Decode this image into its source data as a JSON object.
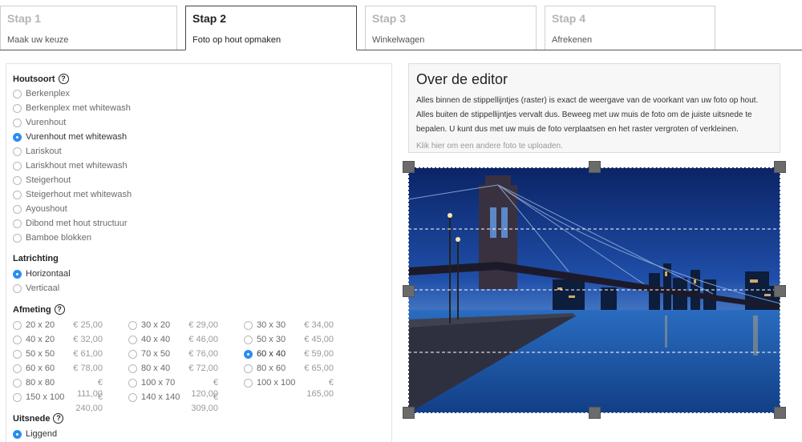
{
  "steps": [
    {
      "title": "Stap 1",
      "subtitle": "Maak uw keuze"
    },
    {
      "title": "Stap 2",
      "subtitle": "Foto op hout opmaken"
    },
    {
      "title": "Stap 3",
      "subtitle": "Winkelwagen"
    },
    {
      "title": "Stap 4",
      "subtitle": "Afrekenen"
    }
  ],
  "houtsoort": {
    "title": "Houtsoort",
    "selected": "Vurenhout met whitewash",
    "options": [
      "Berkenplex",
      "Berkenplex met whitewash",
      "Vurenhout",
      "Vurenhout met whitewash",
      "Lariskout",
      "Lariskhout met whitewash",
      "Steigerhout",
      "Steigerhout met whitewash",
      "Ayoushout",
      "Dibond met hout structuur",
      "Bamboe blokken"
    ]
  },
  "latrichting": {
    "title": "Latrichting",
    "selected": "Horizontaal",
    "options": [
      "Horizontaal",
      "Verticaal"
    ]
  },
  "afmeting": {
    "title": "Afmeting",
    "selected": "60 x 40",
    "columns": [
      [
        {
          "size": "20 x 20",
          "price": "€ 25,00"
        },
        {
          "size": "40 x 20",
          "price": "€ 32,00"
        },
        {
          "size": "50 x 50",
          "price": "€ 61,00"
        },
        {
          "size": "60 x 60",
          "price": "€ 78,00"
        },
        {
          "size": "80 x 80",
          "price": "€ 111,00"
        },
        {
          "size": "150 x 100",
          "price": "€ 240,00"
        }
      ],
      [
        {
          "size": "30 x 20",
          "price": "€ 29,00"
        },
        {
          "size": "40 x 40",
          "price": "€ 46,00"
        },
        {
          "size": "70 x 50",
          "price": "€ 76,00"
        },
        {
          "size": "80 x 40",
          "price": "€ 72,00"
        },
        {
          "size": "100 x 70",
          "price": "€ 120,00"
        },
        {
          "size": "140 x 140",
          "price": "€ 309,00"
        }
      ],
      [
        {
          "size": "30 x 30",
          "price": "€ 34,00"
        },
        {
          "size": "50 x 30",
          "price": "€ 45,00"
        },
        {
          "size": "60 x 40",
          "price": "€ 59,00"
        },
        {
          "size": "80 x 60",
          "price": "€ 65,00"
        },
        {
          "size": "100 x 100",
          "price": "€ 165,00"
        }
      ]
    ]
  },
  "uitsnede": {
    "title": "Uitsnede",
    "selected": "Liggend",
    "options": [
      "Liggend"
    ]
  },
  "editor_info": {
    "title": "Over de editor",
    "text": "Alles binnen de stippellijntjes (raster) is exact de weergave van de voorkant van uw foto op hout. Alles buiten de stippellijntjes vervalt dus. Beweeg met uw muis de foto om de juiste uitsnede te bepalen. U kunt dus met uw muis de foto verplaatsen en het raster vergroten of verkleinen.",
    "upload_link": "Klik hier om een andere foto te uploaden."
  },
  "colors": {
    "accent": "#2b8df0",
    "sky_top": "#0d2a6b",
    "water": "#1d5fa8"
  }
}
